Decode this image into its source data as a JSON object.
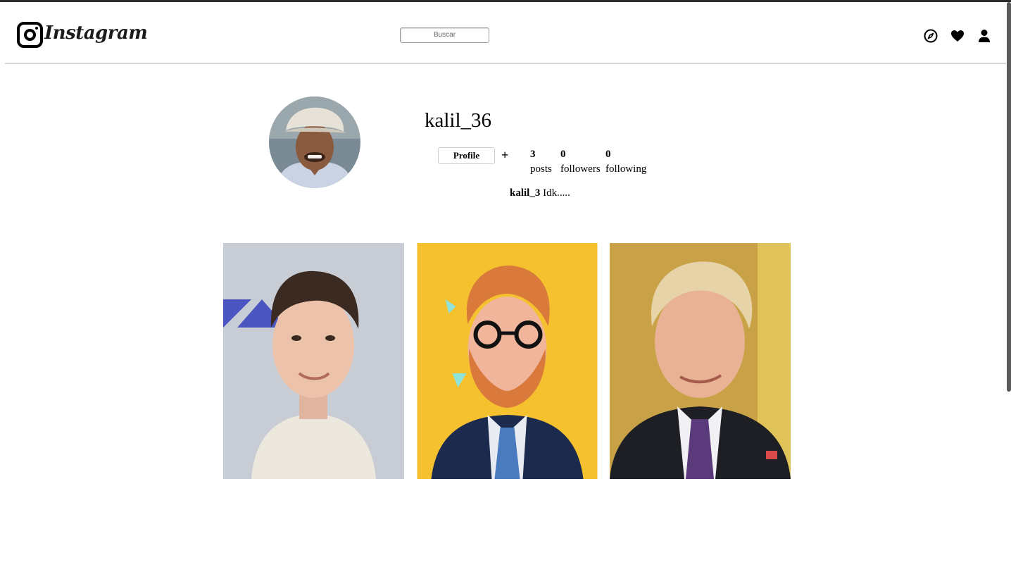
{
  "app": {
    "logo_text": "Instagram"
  },
  "search": {
    "placeholder": "Buscar"
  },
  "nav": {
    "icons": [
      "compass-icon",
      "heart-icon",
      "user-icon"
    ]
  },
  "profile": {
    "username": "kalil_36",
    "button_label": "Profile",
    "add_label": "+",
    "stats": [
      {
        "value": "3",
        "label": "posts"
      },
      {
        "value": "0",
        "label": "followers"
      },
      {
        "value": "0",
        "label": "following"
      }
    ],
    "bio_name": "kalil_3",
    "bio_text": " Idk....."
  },
  "colors": {
    "accent_dark": "#2b2b2b",
    "divider": "#d6d6d6",
    "post1_bg": "#c8cdd5",
    "post2_bg": "#f5c12e",
    "post3_bg": "#c9a248"
  }
}
